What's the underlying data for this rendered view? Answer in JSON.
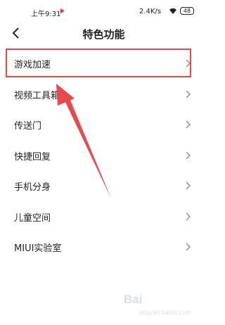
{
  "status_bar": {
    "time": "上午9:31",
    "network_speed": "2.4K/s",
    "battery": "48",
    "icons": [
      "app-notification-icon",
      "wifi-icon",
      "battery-icon"
    ]
  },
  "header": {
    "title": "特色功能",
    "back_icon": "chevron-left-icon"
  },
  "list": {
    "items": [
      {
        "label": "游戏加速",
        "highlighted": true
      },
      {
        "label": "视频工具箱"
      },
      {
        "label": "传送门"
      },
      {
        "label": "快捷回复"
      },
      {
        "label": "手机分身"
      },
      {
        "label": "儿童空间"
      },
      {
        "label": "MIUI实验室"
      }
    ],
    "item_icon": "chevron-right-icon"
  },
  "annotation": {
    "highlight_color": "#e8484e",
    "arrow_color": "#e8484e"
  },
  "watermark": {
    "text": "Bai",
    "sub": "jingyan.baidu.com"
  }
}
